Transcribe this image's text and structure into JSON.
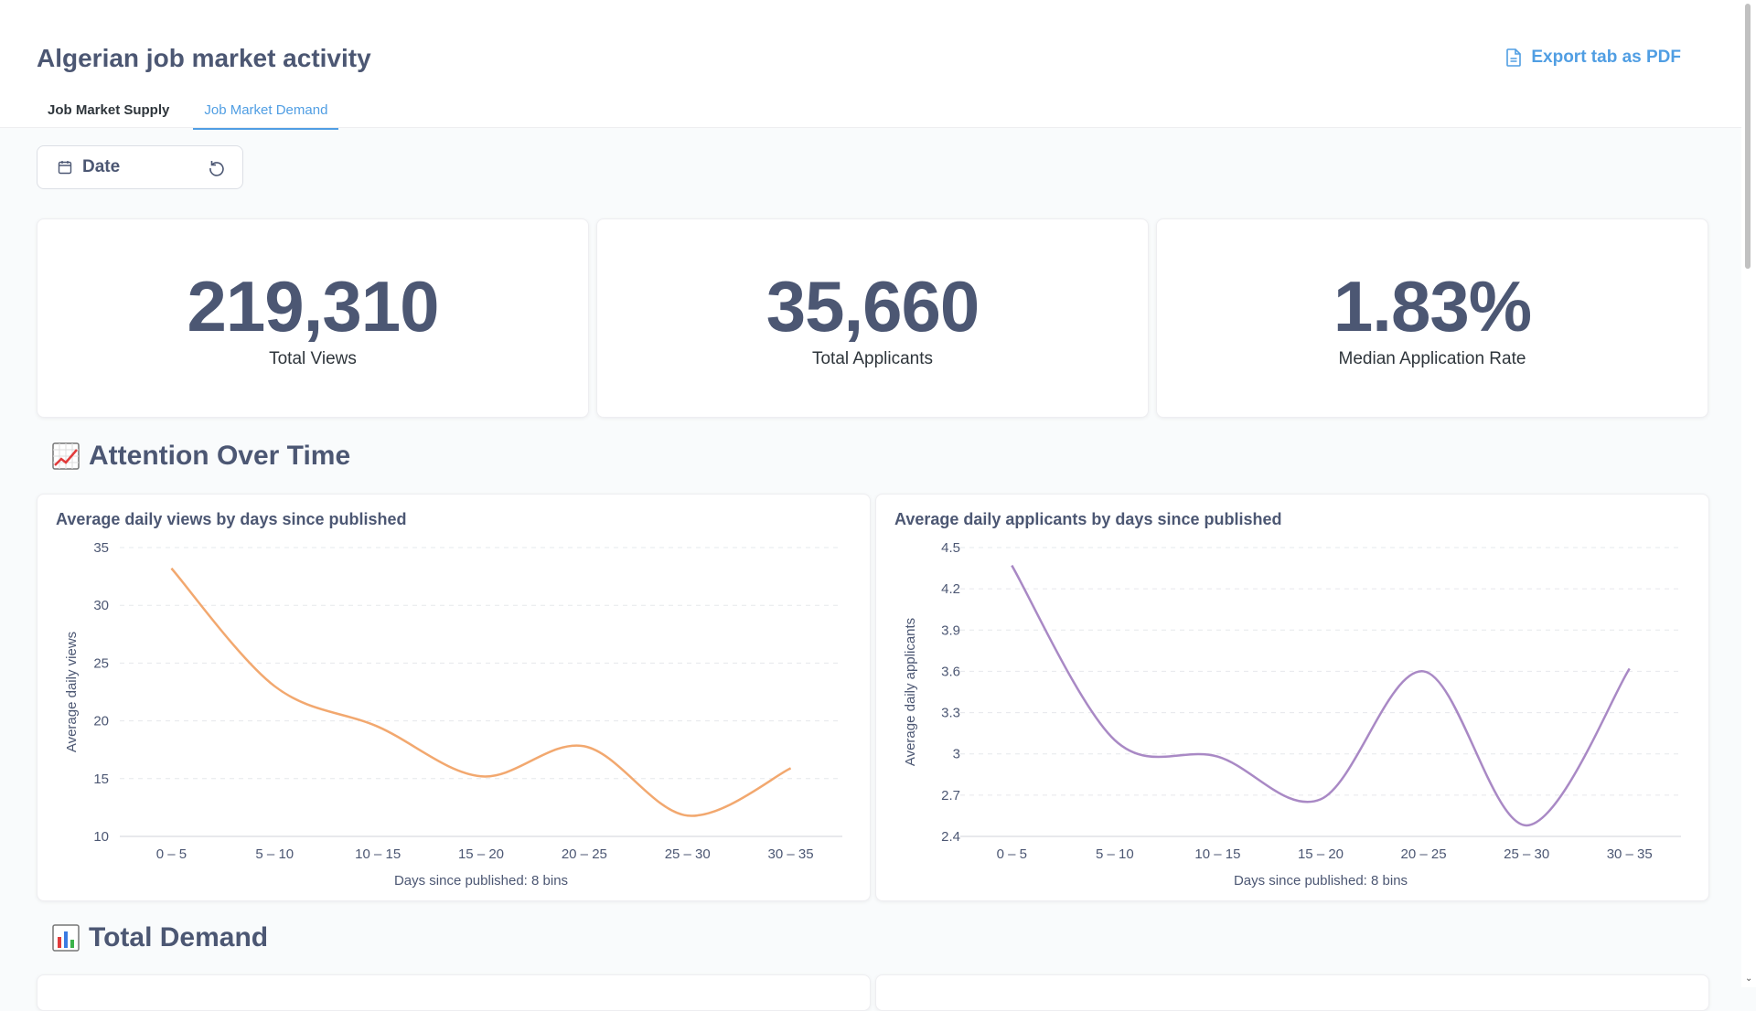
{
  "page": {
    "title": "Algerian job market activity",
    "export_label": "Export tab as PDF",
    "tabs": [
      {
        "label": "Job Market Supply",
        "active": false
      },
      {
        "label": "Job Market Demand",
        "active": true
      }
    ]
  },
  "filter": {
    "label": "Date"
  },
  "kpis": [
    {
      "value": "219,310",
      "label": "Total Views"
    },
    {
      "value": "35,660",
      "label": "Total Applicants"
    },
    {
      "value": "1.83%",
      "label": "Median Application Rate"
    }
  ],
  "sections": [
    {
      "title": "Attention Over Time",
      "icon": "chart-increasing-icon"
    },
    {
      "title": "Total Demand",
      "icon": "bar-chart-icon"
    }
  ],
  "colors": {
    "accent": "#509ee3",
    "views_line": "#f2a86f",
    "applicants_line": "#a989c5"
  },
  "chart_data": [
    {
      "type": "line",
      "title": "Average daily views by days since published",
      "xlabel": "Days since published: 8 bins",
      "ylabel": "Average daily views",
      "categories": [
        "0 – 5",
        "5 – 10",
        "10 – 15",
        "15 – 20",
        "20 – 25",
        "25 – 30",
        "30 – 35"
      ],
      "values": [
        33.2,
        23.0,
        19.5,
        15.2,
        17.8,
        11.8,
        15.9
      ],
      "ylim": [
        10,
        35
      ],
      "yticks": [
        "10",
        "15",
        "20",
        "25",
        "30",
        "35"
      ],
      "grid": true
    },
    {
      "type": "line",
      "title": "Average daily applicants by days since published",
      "xlabel": "Days since published: 8 bins",
      "ylabel": "Average daily applicants",
      "categories": [
        "0 – 5",
        "5 – 10",
        "10 – 15",
        "15 – 20",
        "20 – 25",
        "25 – 30",
        "30 – 35"
      ],
      "values": [
        4.37,
        3.1,
        2.98,
        2.67,
        3.6,
        2.48,
        3.62
      ],
      "ylim": [
        2.4,
        4.5
      ],
      "yticks": [
        "2.4",
        "2.7",
        "3",
        "3.3",
        "3.6",
        "3.9",
        "4.2",
        "4.5"
      ],
      "grid": true
    }
  ]
}
